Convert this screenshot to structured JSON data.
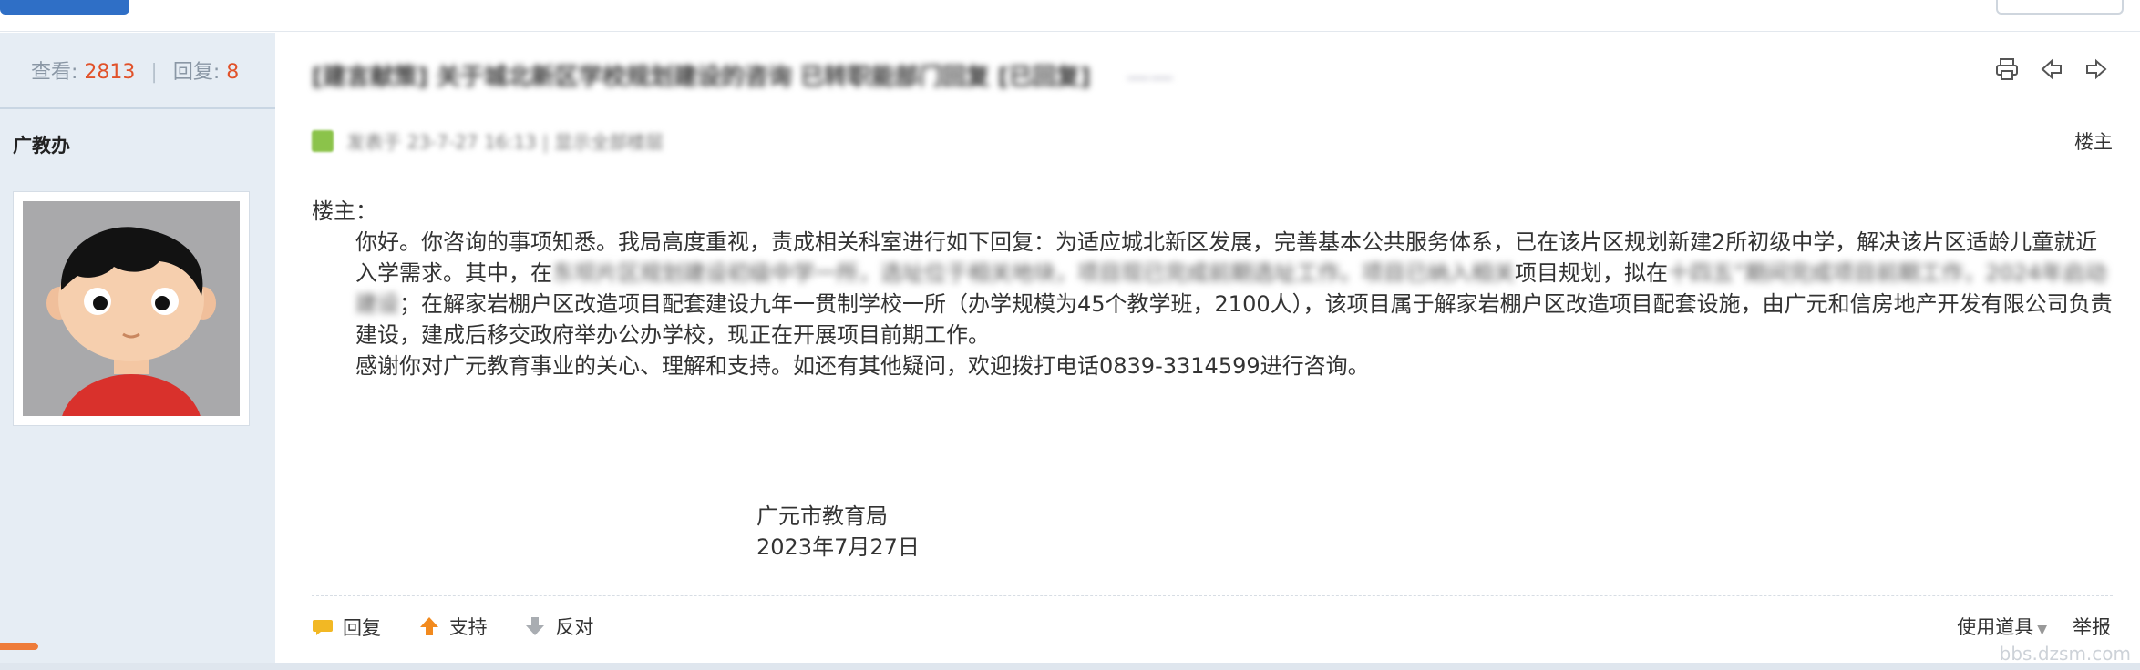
{
  "stats": {
    "views_label": "查看:",
    "views": "2813",
    "replies_label": "回复:",
    "replies": "8"
  },
  "author": "广教办",
  "thread": {
    "title_blurred": "[建言献策] 关于城北新区学校规划建设的咨询 已转职能部门回复 [已回复]",
    "title_suffix_blurred": "——"
  },
  "post": {
    "meta_blurred": "发表于 23-7-27 16:13 | 显示全部楼层",
    "floor": "楼主",
    "greeting": "楼主：",
    "para1_a": "你好。你咨询的事项知悉。我局高度重视，责成相关科室进行如下回复：为适应城北新区发展，完善基本公共服务体系，已在该片区规划新建2所初级中学，解决该片区适龄儿童就近入学需求。其中，在",
    "para1_blur1": "东坝片区规划建设初级中学一所，选址位于相关地块，项目现已完成前期选址工作。项目已纳入相关",
    "para1_b": "项目规划，拟在",
    "para1_blur2": "十四五”期间完成项目前期工作，2024年启动建设",
    "para1_c": "；在解家岩棚户区改造项目配套建设九年一贯制学校一所（办学规模为45个教学班，2100人），该项目属于解家岩棚户区改造项目配套设施，由广元和信房地产开发有限公司负责建设，建成后移交政府举办公办学校，现正在开展项目前期工作。",
    "para2": "感谢你对广元教育事业的关心、理解和支持。如还有其他疑问，欢迎拨打电话0839-3314599进行咨询。",
    "signature_org": "广元市教育局",
    "signature_date": "2023年7月27日"
  },
  "actions": {
    "reply": "回复",
    "support": "支持",
    "oppose": "反对",
    "tools": "使用道具",
    "report": "举报"
  },
  "watermark": "bbs.dzsm.com",
  "icons": [
    "print-icon",
    "prev-arrow-icon",
    "next-arrow-icon",
    "reply-bubble-icon",
    "thumb-up-arrow-icon",
    "thumb-down-arrow-icon"
  ],
  "colors": {
    "stat_number": "#e1522a",
    "sidebar_bg": "#e6edf4",
    "accent_orange": "#ee7c3a"
  }
}
